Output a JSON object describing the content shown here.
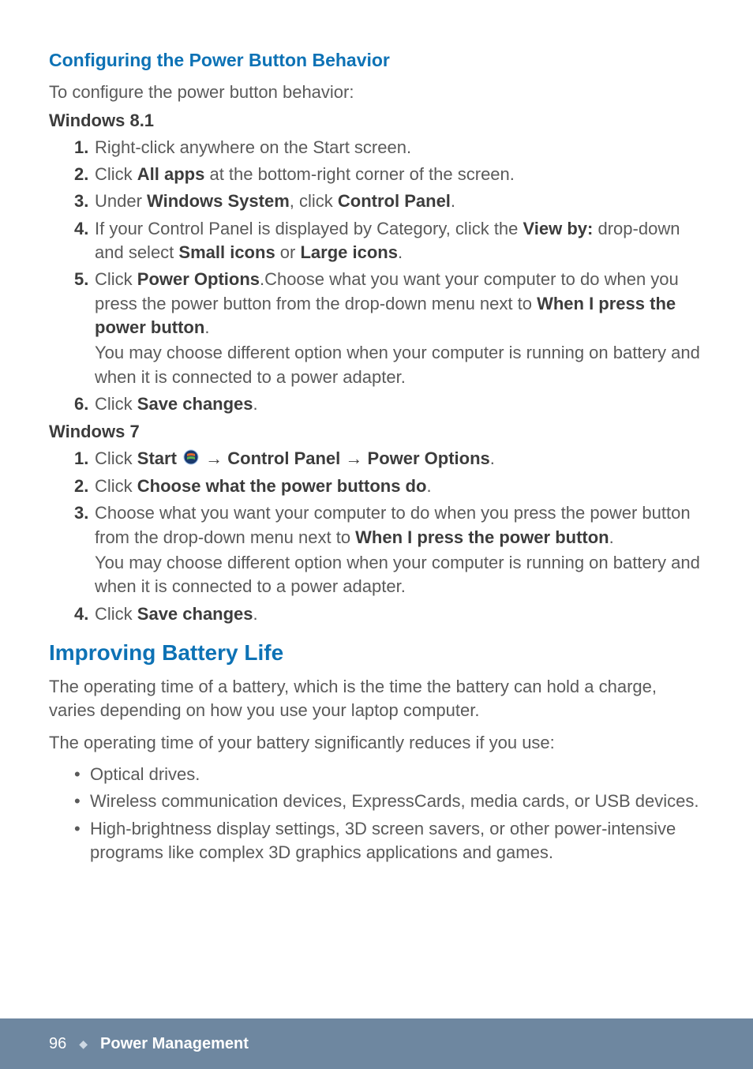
{
  "heading_config": "Configuring the Power Button Behavior",
  "intro_config": "To configure the power button behavior:",
  "win81_heading": "Windows 8.1",
  "win81_steps": {
    "s1": {
      "num": "1.",
      "text": "Right-click anywhere on the Start screen."
    },
    "s2": {
      "num": "2.",
      "pre": "Click ",
      "b1": "All apps",
      "post": " at the bottom-right corner of the screen."
    },
    "s3": {
      "num": "3.",
      "pre": "Under ",
      "b1": "Windows System",
      "mid": ", click ",
      "b2": "Control Panel",
      "post": "."
    },
    "s4": {
      "num": "4.",
      "pre": "If your Control Panel is displayed by Category, click the ",
      "b1": "View by:",
      "mid": " drop-down and select ",
      "b2": "Small icons",
      "mid2": " or ",
      "b3": "Large icons",
      "post": "."
    },
    "s5": {
      "num": "5.",
      "pre": "Click ",
      "b1": "Power Options",
      "mid": ".Choose what you want your computer to do when you press the power button from the drop-down menu next to ",
      "b2": "When I press the power button",
      "post": ".",
      "sub": "You may choose different option when your computer is running on battery and when it is connected to a power adapter."
    },
    "s6": {
      "num": "6.",
      "pre": "Click ",
      "b1": "Save changes",
      "post": "."
    }
  },
  "win7_heading": "Windows 7",
  "win7_steps": {
    "s1": {
      "num": "1.",
      "pre": "Click ",
      "b1": "Start ",
      "arrow": " → ",
      "b2": "Control Panel",
      "arrow2": " → ",
      "b3": "Power Options",
      "post": "."
    },
    "s2": {
      "num": "2.",
      "pre": "Click ",
      "b1": "Choose what the power buttons do",
      "post": "."
    },
    "s3": {
      "num": "3.",
      "pre": "Choose what you want your computer to do when you press the power button from the drop-down menu next to ",
      "b1": "When I press the power button",
      "post": ".",
      "sub": "You may choose different option when your computer is running on battery and when it is connected to a power adapter."
    },
    "s4": {
      "num": "4.",
      "pre": "Click ",
      "b1": "Save changes",
      "post": "."
    }
  },
  "heading_battery": "Improving Battery Life",
  "battery_p1": "The operating time of a battery, which is the time the battery can hold a charge, varies depending on how you use your laptop computer.",
  "battery_p2": "The operating time of your battery significantly reduces if you use:",
  "battery_bullets": {
    "b1": "Optical drives.",
    "b2": "Wireless communication devices, ExpressCards, media cards, or USB devices.",
    "b3": "High-brightness display settings, 3D screen savers, or other power-intensive programs like complex 3D graphics applications and games."
  },
  "footer": {
    "page": "96",
    "diamond": "◆",
    "section": "Power Management"
  }
}
